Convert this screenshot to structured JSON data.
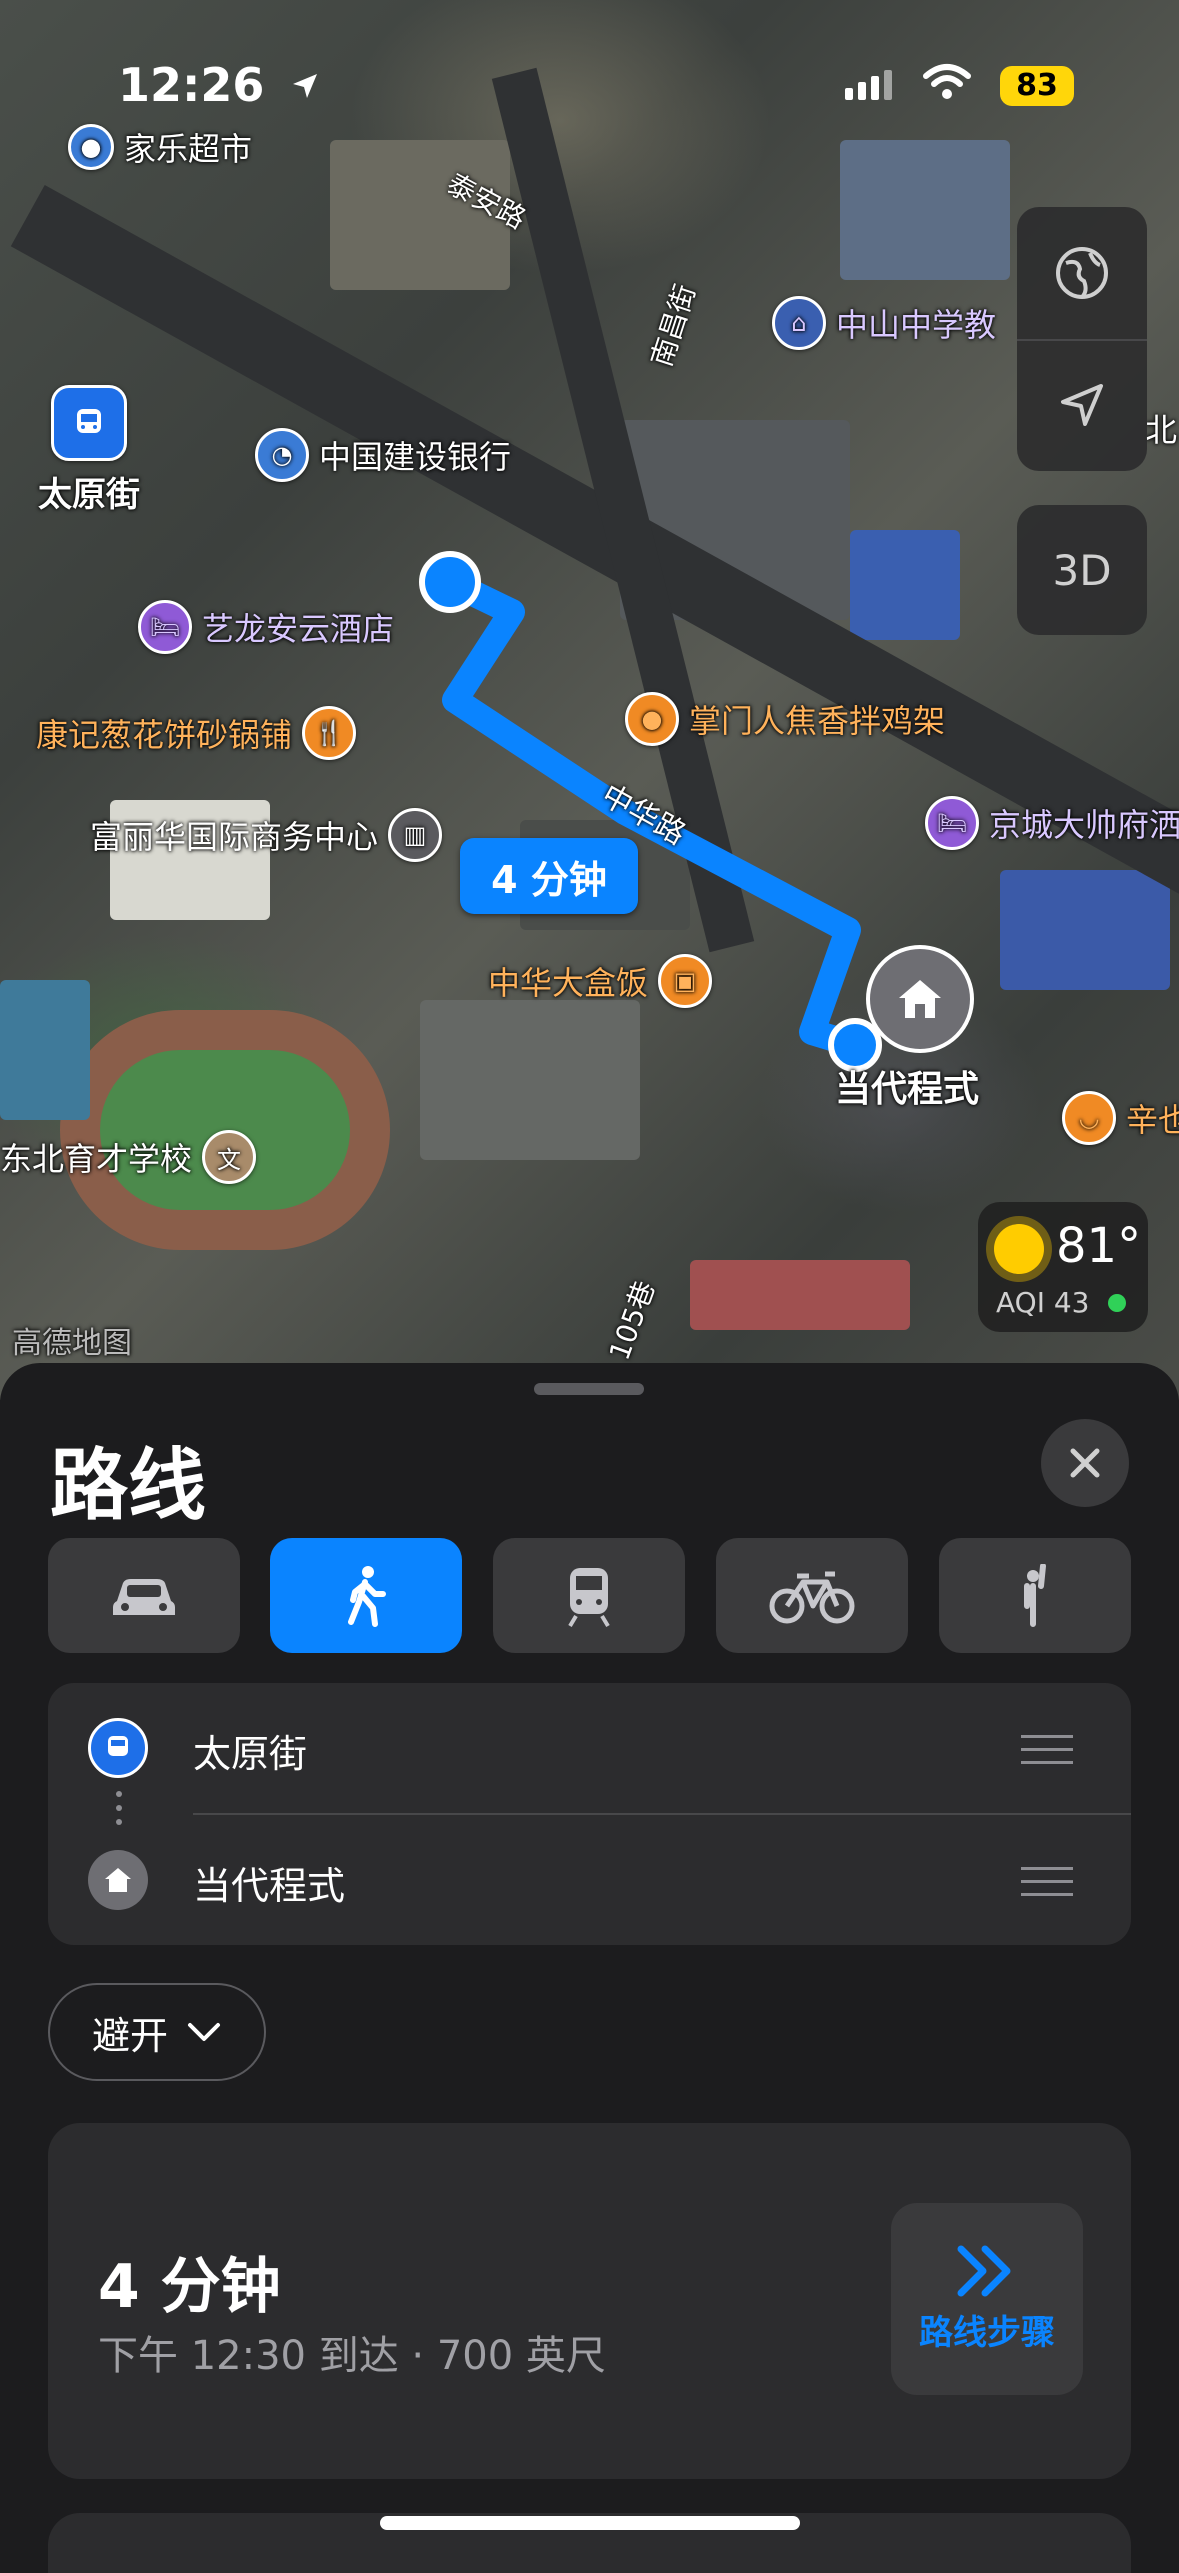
{
  "status_bar": {
    "time": "12:26",
    "battery": "83"
  },
  "map": {
    "pois": {
      "jialechaoshi": "家乐超市",
      "taiyuanjie": "太原街",
      "jianshe_bank": "中国建设银行",
      "yilong_hotel": "艺龙安云酒店",
      "kangji": "康记葱花饼砂锅铺",
      "fulihua": "富丽华国际商务中心",
      "zhanmen": "掌门人焦香拌鸡架",
      "jingcheng": "京城大帅府洒",
      "zhonghua_box": "中华大盒饭",
      "dongbei_school": "东北育才学校",
      "zhongshan_school": "中山中学教",
      "bei": "北",
      "destination": "当代程式",
      "xinpartial": "辛也"
    },
    "roads": {
      "taian": "泰安路",
      "nanchang": "南昌街",
      "zhonghua": "中华路",
      "lane105": "105巷"
    },
    "route_badge": "4 分钟",
    "watermark": "高德地图",
    "weather": {
      "temp": "81°",
      "aqi": "AQI 43"
    },
    "btn_3d": "3D"
  },
  "sheet": {
    "title": "路线",
    "modes": [
      "car",
      "walk",
      "transit",
      "bike",
      "rideshare"
    ],
    "stops": [
      {
        "label": "太原街",
        "icon": "subway-icon"
      },
      {
        "label": "当代程式",
        "icon": "home-icon"
      }
    ],
    "avoid_label": "避开",
    "route": {
      "duration": "4 分钟",
      "detail": "下午 12:30 到达 · 700 英尺",
      "steps_label": "路线步骤"
    }
  }
}
